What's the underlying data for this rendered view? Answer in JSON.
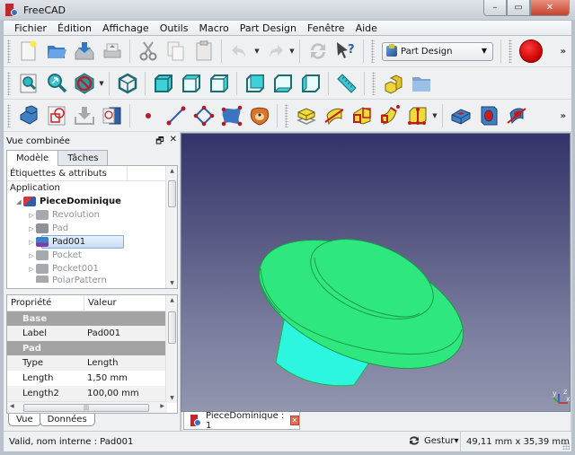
{
  "window": {
    "title": "FreeCAD",
    "controls": {
      "minimize": "–",
      "maximize": "▭",
      "close": "✕"
    }
  },
  "menubar": {
    "items": [
      "Fichier",
      "Édition",
      "Affichage",
      "Outils",
      "Macro",
      "Part Design",
      "Fenêtre",
      "Aide"
    ]
  },
  "toolbars": {
    "file": [
      "new-document-icon",
      "open-folder-icon",
      "save-icon",
      "print-icon"
    ],
    "edit": [
      "cut-icon",
      "copy-icon",
      "paste-icon",
      "undo-icon",
      "redo-icon",
      "refresh-icon",
      "whats-this-icon"
    ],
    "workbench_selector": {
      "selected": "Part Design",
      "caret": "▼"
    },
    "macro_record": "record-macro-icon",
    "more": "»",
    "view": [
      "fit-all-icon",
      "fit-selection-icon",
      "draw-style-icon",
      "isometric-view-icon",
      "front-view-icon",
      "top-view-icon",
      "right-view-icon",
      "rear-view-icon",
      "bottom-view-icon",
      "left-view-icon",
      "measure-distance-icon"
    ],
    "structure": [
      "create-part-icon",
      "create-group-icon"
    ],
    "part_design_helpers": [
      "body-icon",
      "sketch-icon",
      "import-icon",
      "sketch-on-face-icon"
    ],
    "sketcher": [
      "point-icon",
      "line-icon",
      "polyline-icon",
      "bspline-icon",
      "sketcher-freecad-icon"
    ],
    "additive": [
      "pad-icon",
      "revolution-icon",
      "additive-loft-icon",
      "additive-pipe-icon",
      "additive-box-icon"
    ],
    "subtractive": [
      "pocket-icon",
      "hole-icon",
      "groove-icon"
    ]
  },
  "combo_view": {
    "title": "Vue combinée",
    "float_icon": "🗗",
    "close_icon": "✕",
    "tabs": [
      "Modèle",
      "Tâches"
    ],
    "active_tab": "Modèle",
    "tree": {
      "header": "Étiquettes & attributs",
      "root": "Application",
      "items": [
        {
          "label": "PieceDominique",
          "level": 1,
          "bold": true,
          "expanded": true,
          "icon": "document-icon"
        },
        {
          "label": "Revolution",
          "level": 2,
          "dim": true,
          "icon": "revolution-feature-icon"
        },
        {
          "label": "Pad",
          "level": 2,
          "dim": true,
          "icon": "pad-feature-icon"
        },
        {
          "label": "Pad001",
          "level": 2,
          "selected": true,
          "icon": "pad-feature-icon"
        },
        {
          "label": "Pocket",
          "level": 2,
          "dim": true,
          "icon": "pocket-feature-icon"
        },
        {
          "label": "Pocket001",
          "level": 2,
          "dim": true,
          "icon": "pocket-feature-icon"
        },
        {
          "label": "PolarPattern",
          "level": 2,
          "dim": true,
          "icon": "polar-pattern-icon"
        }
      ]
    },
    "properties": {
      "headers": [
        "Propriété",
        "Valeur"
      ],
      "groups": [
        {
          "name": "Base",
          "rows": [
            {
              "name": "Label",
              "value": "Pad001"
            }
          ]
        },
        {
          "name": "Pad",
          "rows": [
            {
              "name": "Type",
              "value": "Length"
            },
            {
              "name": "Length",
              "value": "1,50 mm"
            },
            {
              "name": "Length2",
              "value": "100,00 mm"
            }
          ]
        }
      ]
    },
    "bottom_tabs": [
      "Vue",
      "Données"
    ],
    "active_bottom_tab": "Données"
  },
  "view3d": {
    "axis_labels": {
      "x": "x",
      "y": "y",
      "z": "z"
    },
    "model_color": "#2ee87f",
    "model_side_color": "#2cf5e0"
  },
  "document_tabs": [
    {
      "label": "PieceDominique : 1",
      "close": "✕"
    }
  ],
  "statusbar": {
    "message": "Valid, nom interne : Pad001",
    "navigation_style": "Gestur▾",
    "dimensions": "49,11 mm x 35,39 mm"
  }
}
